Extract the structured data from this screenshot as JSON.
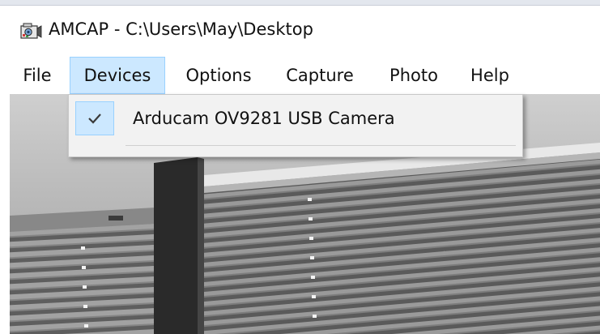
{
  "window": {
    "title": "AMCAP - C:\\Users\\May\\Desktop",
    "icon": "camera-app-icon"
  },
  "menubar": {
    "items": [
      {
        "label": "File"
      },
      {
        "label": "Devices",
        "active": true
      },
      {
        "label": "Options"
      },
      {
        "label": "Capture"
      },
      {
        "label": "Photo"
      },
      {
        "label": "Help"
      }
    ]
  },
  "devices_menu": {
    "items": [
      {
        "label": "Arducam OV9281 USB Camera",
        "checked": true,
        "icon": "checkmark-icon"
      }
    ]
  },
  "colors": {
    "menu_highlight": "#cce8ff",
    "menu_highlight_border": "#99d1ff",
    "dropdown_bg": "#f2f2f2",
    "check_color": "#3a3a3a"
  },
  "video_preview": {
    "content": "camera-feed-blinds"
  }
}
